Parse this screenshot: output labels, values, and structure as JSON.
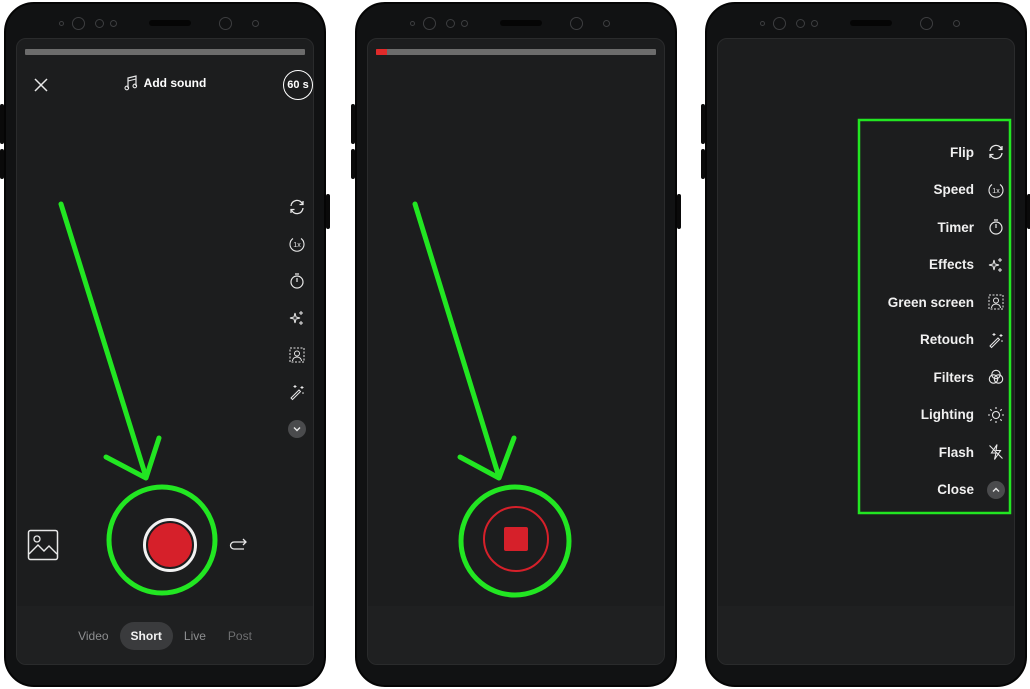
{
  "annotation_color": "#22e622",
  "phones": [
    {
      "name": "camera-ready",
      "progress_percent": 0,
      "top_bar": {
        "close_icon": "close-icon",
        "add_sound_label": "Add sound",
        "music_icon": "music-note-icon",
        "duration_label": "60 s"
      },
      "side_tools": [
        {
          "icon": "flip-camera-icon"
        },
        {
          "icon": "speed-1x-icon"
        },
        {
          "icon": "timer-icon"
        },
        {
          "icon": "effects-sparkle-icon"
        },
        {
          "icon": "green-screen-icon"
        },
        {
          "icon": "retouch-wand-icon"
        },
        {
          "icon": "chevron-down-icon"
        }
      ],
      "gallery_icon": "gallery-image-icon",
      "record_button": "record-button",
      "flip_icon": "flip-camera-arrow-icon",
      "modes": [
        {
          "label": "Video",
          "active": false
        },
        {
          "label": "Short",
          "active": true
        },
        {
          "label": "Live",
          "active": false
        },
        {
          "label": "Post",
          "active": false
        }
      ]
    },
    {
      "name": "recording",
      "progress_percent": 4,
      "stop_button": "stop-recording-button"
    },
    {
      "name": "tools-expanded",
      "menu": [
        {
          "label": "Flip",
          "icon": "flip-camera-icon"
        },
        {
          "label": "Speed",
          "icon": "speed-1x-icon"
        },
        {
          "label": "Timer",
          "icon": "timer-icon"
        },
        {
          "label": "Effects",
          "icon": "effects-sparkle-icon"
        },
        {
          "label": "Green screen",
          "icon": "green-screen-icon"
        },
        {
          "label": "Retouch",
          "icon": "retouch-wand-icon"
        },
        {
          "label": "Filters",
          "icon": "filters-icon"
        },
        {
          "label": "Lighting",
          "icon": "lighting-sun-icon"
        },
        {
          "label": "Flash",
          "icon": "flash-off-icon"
        },
        {
          "label": "Close",
          "icon": "chevron-up-icon"
        }
      ]
    }
  ],
  "speed_icon_text": "1x"
}
